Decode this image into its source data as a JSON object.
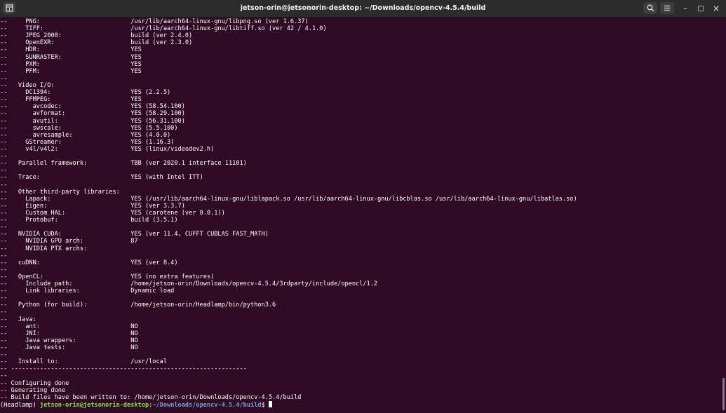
{
  "window": {
    "title": "jetson-orin@jetsonorin-desktop: ~/Downloads/opencv-4.5.4/build",
    "controls": {
      "minimize": "–",
      "maximize": "□",
      "close": "×"
    }
  },
  "terminal": {
    "lines": [
      "--     PNG:                         /usr/lib/aarch64-linux-gnu/libpng.so (ver 1.6.37)",
      "--     TIFF:                        /usr/lib/aarch64-linux-gnu/libtiff.so (ver 42 / 4.1.0)",
      "--     JPEG 2000:                   build (ver 2.4.0)",
      "--     OpenEXR:                     build (ver 2.3.0)",
      "--     HDR:                         YES",
      "--     SUNRASTER:                   YES",
      "--     PXM:                         YES",
      "--     PFM:                         YES",
      "--",
      "--   Video I/O:",
      "--     DC1394:                      YES (2.2.5)",
      "--     FFMPEG:                      YES",
      "--       avcodec:                   YES (58.54.100)",
      "--       avformat:                  YES (58.29.100)",
      "--       avutil:                    YES (56.31.100)",
      "--       swscale:                   YES (5.5.100)",
      "--       avresample:                YES (4.0.0)",
      "--     GStreamer:                   YES (1.16.3)",
      "--     v4l/v4l2:                    YES (linux/videodev2.h)",
      "--",
      "--   Parallel framework:            TBB (ver 2020.1 interface 11101)",
      "--",
      "--   Trace:                         YES (with Intel ITT)",
      "--",
      "--   Other third-party libraries:",
      "--     Lapack:                      YES (/usr/lib/aarch64-linux-gnu/liblapack.so /usr/lib/aarch64-linux-gnu/libcblas.so /usr/lib/aarch64-linux-gnu/libatlas.so)",
      "--     Eigen:                       YES (ver 3.3.7)",
      "--     Custom HAL:                  YES (carotene (ver 0.0.1))",
      "--     Protobuf:                    build (3.5.1)",
      "--",
      "--   NVIDIA CUDA:                   YES (ver 11.4, CUFFT CUBLAS FAST_MATH)",
      "--     NVIDIA GPU arch:             87",
      "--     NVIDIA PTX archs:",
      "--",
      "--   cuDNN:                         YES (ver 8.4)",
      "--",
      "--   OpenCL:                        YES (no extra features)",
      "--     Include path:                /home/jetson-orin/Downloads/opencv-4.5.4/3rdparty/include/opencl/1.2",
      "--     Link libraries:              Dynamic load",
      "--",
      "--   Python (for build):            /home/jetson-orin/Headlamp/bin/python3.6",
      "--",
      "--   Java:",
      "--     ant:                         NO",
      "--     JNI:                         NO",
      "--     Java wrappers:               NO",
      "--     Java tests:                  NO",
      "--",
      "--   Install to:                    /usr/local",
      "-- -----------------------------------------------------------------",
      "--",
      "-- Configuring done",
      "-- Generating done",
      "-- Build files have been written to: /home/jetson-orin/Downloads/opencv-4.5.4/build"
    ],
    "prompt": {
      "env": "(Headlamp) ",
      "user_host": "jetson-orin@jetsonorin-desktop",
      "separator": ":",
      "path": "~/Downloads/opencv-4.5.4/build",
      "symbol": "$ "
    }
  },
  "colors": {
    "background": "#300a24",
    "prompt_user": "#8ae234",
    "prompt_path": "#729fcf",
    "titlebar": "#2c2c2c"
  },
  "icons": [
    "new-tab-icon",
    "search-icon",
    "hamburger-menu-icon",
    "minimize-icon",
    "maximize-icon",
    "close-icon"
  ]
}
